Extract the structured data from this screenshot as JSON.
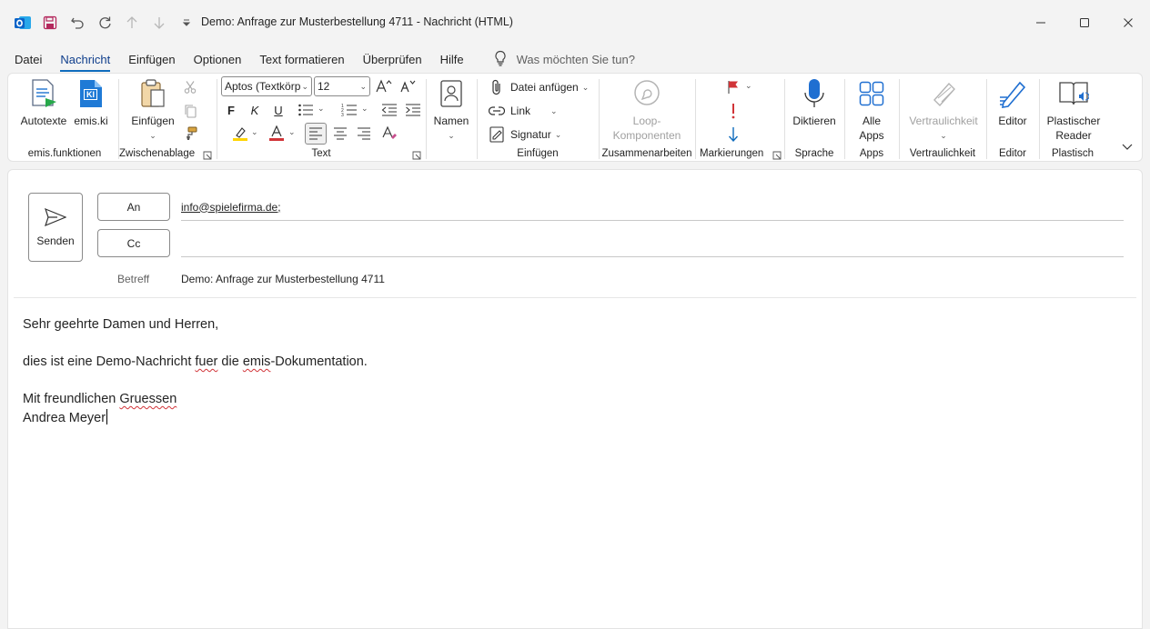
{
  "window": {
    "title": "Demo: Anfrage zur Musterbestellung 4711  -  Nachricht (HTML)"
  },
  "menu": {
    "tabs": [
      "Datei",
      "Nachricht",
      "Einfügen",
      "Optionen",
      "Text formatieren",
      "Überprüfen",
      "Hilfe"
    ],
    "active_tab": "Nachricht",
    "tell_me": "Was möchten Sie tun?"
  },
  "ribbon": {
    "emis": {
      "label": "emis.funktionen",
      "autotexte": "Autotexte",
      "emiski": "emis.ki",
      "ki_badge": "KI"
    },
    "clipboard": {
      "label": "Zwischenablage",
      "paste": "Einfügen"
    },
    "text": {
      "label": "Text",
      "font": "Aptos (Textkörp",
      "size": "12",
      "bold": "F",
      "italic": "K",
      "underline": "U"
    },
    "names": {
      "label": "Namen"
    },
    "insert": {
      "label": "Einfügen",
      "attach": "Datei anfügen",
      "link": "Link",
      "signature": "Signatur"
    },
    "collab": {
      "label": "Zusammenarbeiten",
      "loop_line1": "Loop-",
      "loop_line2": "Komponenten"
    },
    "tags": {
      "label": "Markierungen"
    },
    "voice": {
      "label": "Sprache",
      "dictate": "Diktieren"
    },
    "apps": {
      "label": "Apps",
      "line1": "Alle",
      "line2": "Apps"
    },
    "sensitivity": {
      "label": "Vertraulichkeit",
      "button": "Vertraulichkeit"
    },
    "editor": {
      "label": "Editor",
      "button": "Editor"
    },
    "reader": {
      "label": "Plastisch",
      "line1": "Plastischer",
      "line2": "Reader"
    }
  },
  "compose": {
    "send": "Senden",
    "to_label": "An",
    "cc_label": "Cc",
    "to_value": "info@spielefirma.de;",
    "cc_value": "",
    "subject_label": "Betreff",
    "subject": "Demo: Anfrage zur Musterbestellung 4711",
    "body": {
      "greeting": "Sehr geehrte Damen und Herren,",
      "line1_a": "dies ist eine Demo-Nachricht ",
      "line1_b": "fuer",
      "line1_c": " die ",
      "line1_d": "emis",
      "line1_e": "-Dokumentation.",
      "closing_a": "Mit freundlichen ",
      "closing_b": "Gruessen",
      "signature": "Andrea Meyer"
    }
  },
  "colors": {
    "accent": "#0f6cbd",
    "outlook_blue": "#0a64c8",
    "flag_red": "#d13438",
    "highlight_yellow": "#ffd400",
    "font_red": "#d13438"
  }
}
